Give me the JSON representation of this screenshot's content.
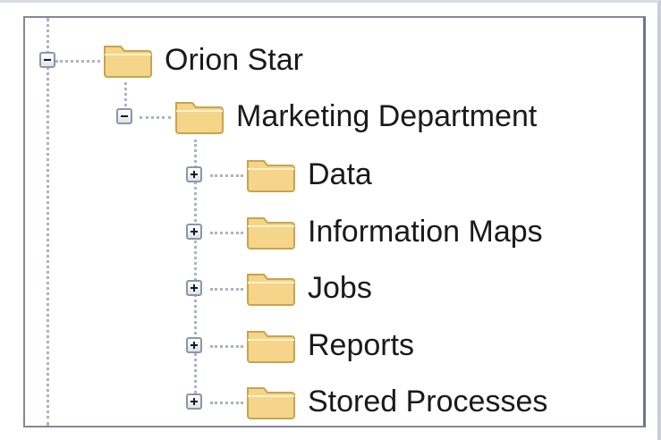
{
  "tree": {
    "root": {
      "label": "Orion Star",
      "state": "expanded",
      "icon": "folder-icon"
    },
    "department": {
      "label": "Marketing Department",
      "state": "expanded",
      "icon": "folder-icon"
    },
    "children": [
      {
        "label": "Data",
        "state": "collapsed",
        "icon": "folder-icon"
      },
      {
        "label": "Information Maps",
        "state": "collapsed",
        "icon": "folder-icon"
      },
      {
        "label": "Jobs",
        "state": "collapsed",
        "icon": "folder-icon"
      },
      {
        "label": "Reports",
        "state": "collapsed",
        "icon": "folder-icon"
      },
      {
        "label": "Stored Processes",
        "state": "collapsed",
        "icon": "folder-icon"
      }
    ]
  },
  "colors": {
    "folder_fill": "#f4d58a",
    "folder_edge": "#caa34d",
    "connector": "#a9b4c4",
    "border": "#7f8a9a"
  }
}
